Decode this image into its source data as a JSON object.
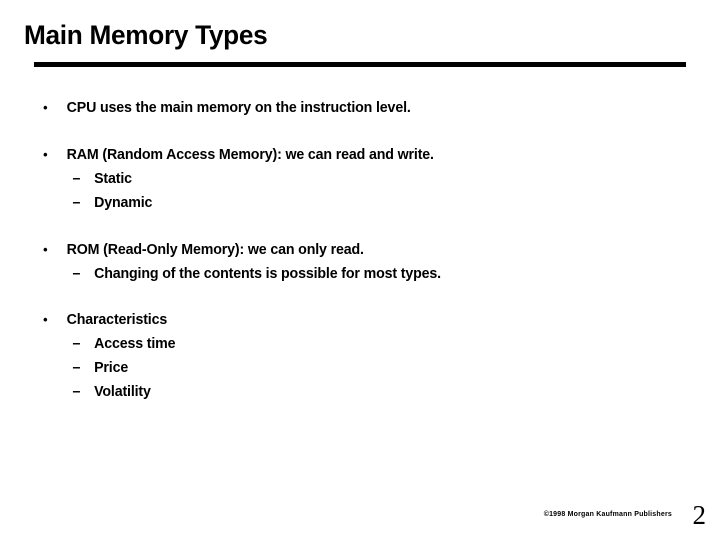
{
  "slide": {
    "title": "Main Memory Types",
    "bullets": [
      {
        "level1": "CPU uses the main memory on the instruction level.",
        "marker": "•",
        "sub": []
      },
      {
        "level1": "RAM (Random Access Memory): we can read and write.",
        "marker": "•",
        "sub": [
          {
            "marker": "–",
            "text": "Static"
          },
          {
            "marker": "–",
            "text": "Dynamic"
          }
        ]
      },
      {
        "level1": "ROM (Read-Only Memory): we can only read.",
        "marker": "•",
        "sub": [
          {
            "marker": "–",
            "text": "Changing of the contents is possible for most types."
          }
        ]
      },
      {
        "level1": "Characteristics",
        "marker": "•",
        "sub": [
          {
            "marker": "–",
            "text": "Access time"
          },
          {
            "marker": "–",
            "text": "Price"
          },
          {
            "marker": "–",
            "text": "Volatility"
          }
        ]
      }
    ],
    "footer": {
      "copyright": "©1998 Morgan Kaufmann Publishers",
      "slide_number": "2"
    },
    "colors": {
      "text": "#000000",
      "background": "#ffffff",
      "rule": "#000000"
    }
  }
}
